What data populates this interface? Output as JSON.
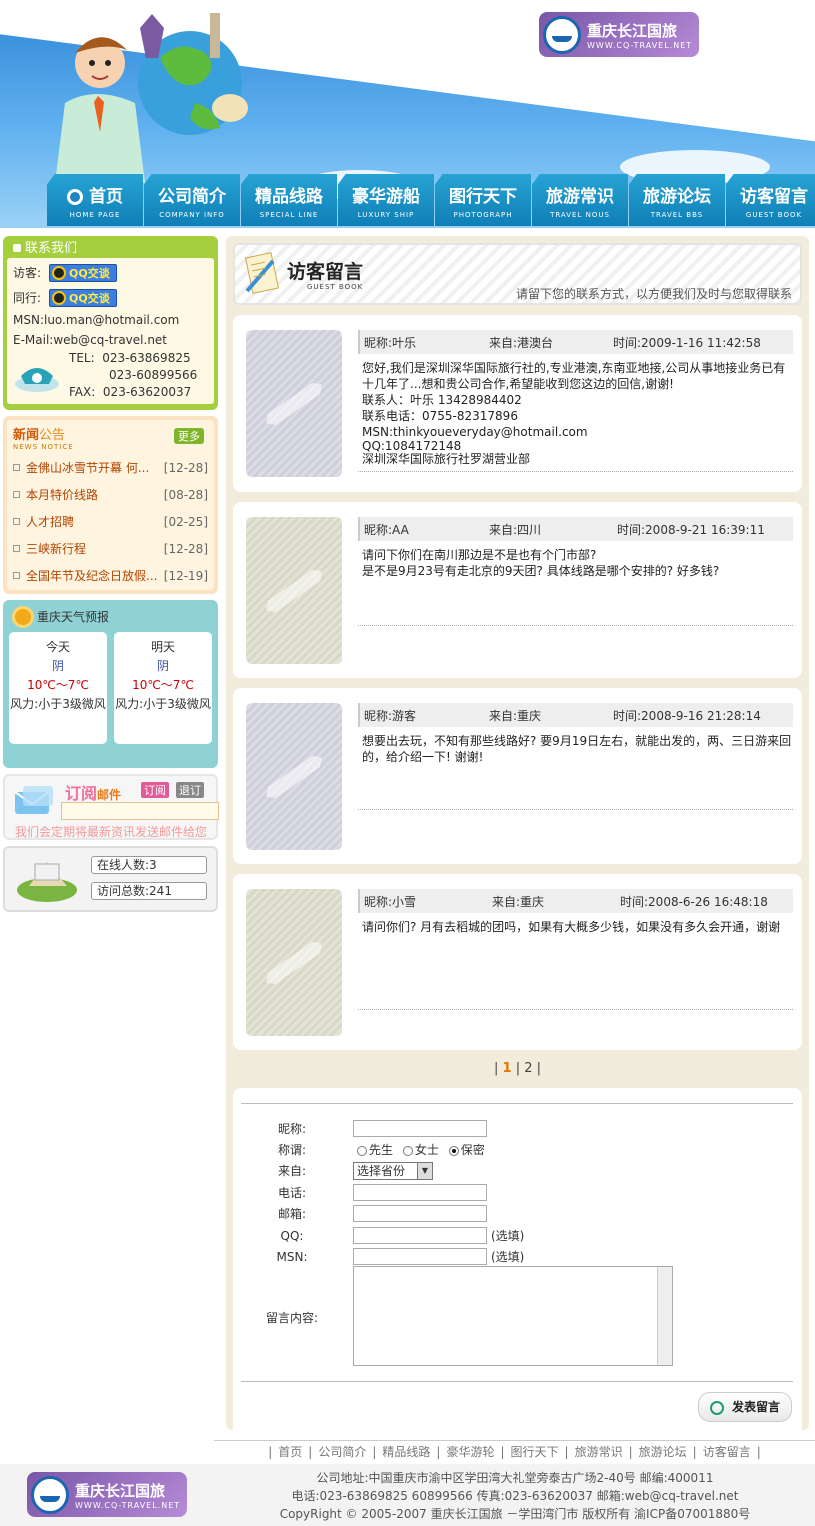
{
  "logo": {
    "cn": "重庆长江国旅",
    "en": "WWW.CQ-TRAVEL.NET"
  },
  "nav": [
    {
      "cn": "首页",
      "en": "HOME PAGE"
    },
    {
      "cn": "公司简介",
      "en": "COMPANY INFO"
    },
    {
      "cn": "精品线路",
      "en": "SPECIAL LINE"
    },
    {
      "cn": "豪华游船",
      "en": "LUXURY SHIP"
    },
    {
      "cn": "图行天下",
      "en": "PHOTOGRAPH"
    },
    {
      "cn": "旅游常识",
      "en": "TRAVEL NOUS"
    },
    {
      "cn": "旅游论坛",
      "en": "TRAVEL BBS"
    },
    {
      "cn": "访客留言",
      "en": "GUEST BOOK"
    }
  ],
  "contact": {
    "title": "联系我们",
    "visitor_label": "访客:",
    "peer_label": "同行:",
    "qq_btn": "QQ交谈",
    "msn": "MSN:luo.man@hotmail.com",
    "email": "E-Mail:web@cq-travel.net",
    "tel_label": "TEL:",
    "tel1": "023-63869825",
    "tel2": "023-60899566",
    "fax_label": "FAX:",
    "fax": "023-63620037"
  },
  "news": {
    "title_a": "新闻",
    "title_b": "公告",
    "en": "NEWS NOTICE",
    "more": "更多",
    "items": [
      {
        "title": "金佛山冰雪节开幕 何...",
        "date": "[12-28]"
      },
      {
        "title": "本月特价线路",
        "date": "[08-28]"
      },
      {
        "title": "人才招聘",
        "date": "[02-25]"
      },
      {
        "title": "三峡新行程",
        "date": "[12-28]"
      },
      {
        "title": "全国年节及纪念日放假...",
        "date": "[12-19]"
      }
    ]
  },
  "weather": {
    "title": "重庆天气预报",
    "days": [
      {
        "day": "今天",
        "cond": "阴",
        "temp": "10℃～7℃",
        "wind": "风力:小于3级微风"
      },
      {
        "day": "明天",
        "cond": "阴",
        "temp": "10℃～7℃",
        "wind": "风力:小于3级微风"
      }
    ]
  },
  "subscribe": {
    "title_a": "订阅",
    "title_b": "邮件",
    "sub_btn": "订阅",
    "unsub_btn": "退订",
    "note": "我们会定期将最新资讯发送邮件给您"
  },
  "stats": {
    "online": "在线人数:3",
    "total": "访问总数:241"
  },
  "banner": {
    "title": "访客留言",
    "en": "GUEST BOOK",
    "tip": "请留下您的联系方式，以方便我们及时与您取得联系"
  },
  "messages": [
    {
      "name": "昵称:叶乐",
      "from": "来自:港澳台",
      "time": "时间:2009-1-16 11:42:58",
      "lines": [
        "您好,我们是深圳深华国际旅行社的,专业港澳,东南亚地接,公司从事地接业务已有十几年了...想和贵公司合作,希望能收到您这边的回信,谢谢!",
        "联系人：叶乐  13428984402",
        "联系电话：0755-82317896",
        "MSN:thinkyoueveryday@hotmail.com",
        "QQ:1084172148",
        "深圳深华国际旅行社罗湖营业部"
      ]
    },
    {
      "name": "昵称:AA",
      "from": "来自:四川",
      "time": "时间:2008-9-21 16:39:11",
      "lines": [
        "请问下你们在南川那边是不是也有个门市部?",
        "是不是9月23号有走北京的9天团? 具体线路是哪个安排的? 好多钱?"
      ]
    },
    {
      "name": "昵称:游客",
      "from": "来自:重庆",
      "time": "时间:2008-9-16 21:28:14",
      "lines": [
        "想要出去玩，不知有那些线路好? 要9月19日左右，就能出发的，两、三日游来回的，给介绍一下! 谢谢!"
      ]
    },
    {
      "name": "昵称:小雪",
      "from": "来自:重庆",
      "time": "时间:2008-6-26 16:48:18",
      "lines": [
        "请问你们? 月有去稻城的团吗，如果有大概多少钱，如果没有多久会开通，谢谢"
      ]
    }
  ],
  "pager": {
    "sep": "|",
    "p1": "1",
    "p2": "2"
  },
  "form": {
    "nick": "昵称:",
    "title": "称谓:",
    "opt_mr": "先生",
    "opt_ms": "女士",
    "opt_secret": "保密",
    "from": "来自:",
    "province": "选择省份",
    "phone": "电话:",
    "email": "邮箱:",
    "qq": "QQ:",
    "msn": "MSN:",
    "optional": "(选填)",
    "content": "留言内容:",
    "submit": "发表留言"
  },
  "footer": {
    "links": [
      "首页",
      "公司简介",
      "精品线路",
      "豪华游轮",
      "图行天下",
      "旅游常识",
      "旅游论坛",
      "访客留言"
    ],
    "address": "公司地址:中国重庆市渝中区学田湾大礼堂旁泰古广场2-40号 邮编:400011",
    "contact": "电话:023-63869825 60899566 传真:023-63620037 邮箱:web@cq-travel.net",
    "copyright": "CopyRight © 2005-2007 重庆长江国旅 －学田湾门市 版权所有 渝ICP备07001880号"
  }
}
